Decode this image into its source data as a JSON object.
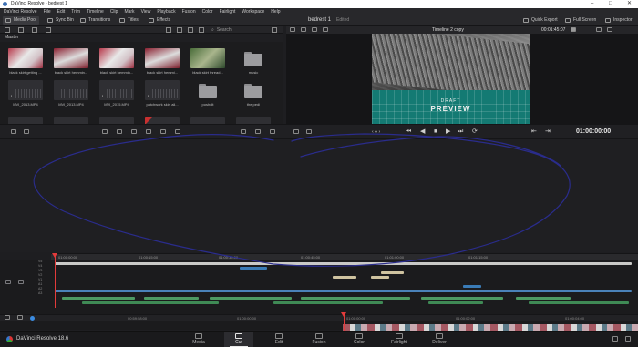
{
  "window": {
    "title": "DaVinci Resolve - bedrest 1",
    "controls": [
      "–",
      "□",
      "✕"
    ]
  },
  "menu": [
    "DaVinci Resolve",
    "File",
    "Edit",
    "Trim",
    "Timeline",
    "Clip",
    "Mark",
    "View",
    "Playback",
    "Fusion",
    "Color",
    "Fairlight",
    "Workspace",
    "Help"
  ],
  "toolbar": {
    "media_pool": "Media Pool",
    "sync_bin": "Sync Bin",
    "transitions": "Transitions",
    "titles": "Titles",
    "effects": "Effects",
    "project_title": "bedrest 1",
    "project_state": "Edited",
    "quick_export": "Quick Export",
    "full_screen": "Full Screen",
    "inspector": "Inspector"
  },
  "media_pool": {
    "search_label": "Search",
    "bin": "Master",
    "clips": [
      {
        "label": "black skirt getting ...",
        "kind": "fabric-red"
      },
      {
        "label": "black skirt hemmin...",
        "kind": "fabric-red2"
      },
      {
        "label": "black skirt hemmin...",
        "kind": "fabric-red"
      },
      {
        "label": "black skirt hemmi...",
        "kind": "fabric-red2"
      },
      {
        "label": "black skirt thread...",
        "kind": "fabric-green"
      },
      {
        "label": "music",
        "kind": "folder"
      },
      {
        "label": "MVI_2013.MP4",
        "kind": "audio"
      },
      {
        "label": "MVI_2013.MP4",
        "kind": "audio"
      },
      {
        "label": "MVI_2015.MP4",
        "kind": "audio"
      },
      {
        "label": "patchwork skirt ali...",
        "kind": "audio"
      },
      {
        "label": "poshdit",
        "kind": "folder"
      },
      {
        "label": "the pedi",
        "kind": "folder"
      }
    ]
  },
  "viewer": {
    "timeline_name": "Timeline 2 copy",
    "source_tc": "00:01:45:07",
    "watermark_small": "DRAFT",
    "watermark_big": "PREVIEW"
  },
  "transport": {
    "timecode": "01:00:00:00",
    "buttons": [
      "⏮",
      "◀",
      "■",
      "▶",
      "⏭",
      "⟳"
    ]
  },
  "timeline": {
    "upper_ruler": [
      "01:00:00:00",
      "01:00:15:00",
      "01:00:30:00",
      "01:00:45:00",
      "01:01:00:00",
      "01:01:15:00"
    ],
    "track_labels": [
      "V5",
      "V4",
      "V3",
      "V2",
      "V1",
      "A1",
      "A2",
      "A3",
      "A4"
    ],
    "lower_ruler": [
      "00:59:58:00",
      "01:00:00:00",
      "01:00:02:00",
      "01:00:04:00"
    ]
  },
  "pages": [
    {
      "label": "Media",
      "active": false
    },
    {
      "label": "Cut",
      "active": true
    },
    {
      "label": "Edit",
      "active": false
    },
    {
      "label": "Fusion",
      "active": false
    },
    {
      "label": "Color",
      "active": false
    },
    {
      "label": "Fairlight",
      "active": false
    },
    {
      "label": "Deliver",
      "active": false
    }
  ],
  "brand": "DaVinci Resolve 18.6",
  "colors": {
    "accent": "#3b6fb4",
    "playhead": "#e23b3b",
    "annotation_ink": "#2a2c8c"
  }
}
